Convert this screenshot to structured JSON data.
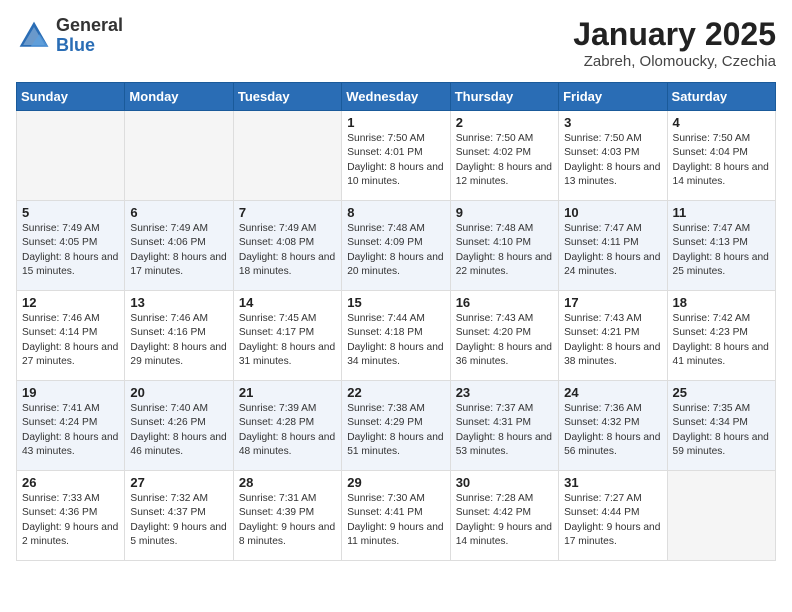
{
  "logo": {
    "general": "General",
    "blue": "Blue"
  },
  "title": "January 2025",
  "subtitle": "Zabreh, Olomoucky, Czechia",
  "days_of_week": [
    "Sunday",
    "Monday",
    "Tuesday",
    "Wednesday",
    "Thursday",
    "Friday",
    "Saturday"
  ],
  "weeks": [
    [
      {
        "day": "",
        "sunrise": "",
        "sunset": "",
        "daylight": ""
      },
      {
        "day": "",
        "sunrise": "",
        "sunset": "",
        "daylight": ""
      },
      {
        "day": "",
        "sunrise": "",
        "sunset": "",
        "daylight": ""
      },
      {
        "day": "1",
        "sunrise": "Sunrise: 7:50 AM",
        "sunset": "Sunset: 4:01 PM",
        "daylight": "Daylight: 8 hours and 10 minutes."
      },
      {
        "day": "2",
        "sunrise": "Sunrise: 7:50 AM",
        "sunset": "Sunset: 4:02 PM",
        "daylight": "Daylight: 8 hours and 12 minutes."
      },
      {
        "day": "3",
        "sunrise": "Sunrise: 7:50 AM",
        "sunset": "Sunset: 4:03 PM",
        "daylight": "Daylight: 8 hours and 13 minutes."
      },
      {
        "day": "4",
        "sunrise": "Sunrise: 7:50 AM",
        "sunset": "Sunset: 4:04 PM",
        "daylight": "Daylight: 8 hours and 14 minutes."
      }
    ],
    [
      {
        "day": "5",
        "sunrise": "Sunrise: 7:49 AM",
        "sunset": "Sunset: 4:05 PM",
        "daylight": "Daylight: 8 hours and 15 minutes."
      },
      {
        "day": "6",
        "sunrise": "Sunrise: 7:49 AM",
        "sunset": "Sunset: 4:06 PM",
        "daylight": "Daylight: 8 hours and 17 minutes."
      },
      {
        "day": "7",
        "sunrise": "Sunrise: 7:49 AM",
        "sunset": "Sunset: 4:08 PM",
        "daylight": "Daylight: 8 hours and 18 minutes."
      },
      {
        "day": "8",
        "sunrise": "Sunrise: 7:48 AM",
        "sunset": "Sunset: 4:09 PM",
        "daylight": "Daylight: 8 hours and 20 minutes."
      },
      {
        "day": "9",
        "sunrise": "Sunrise: 7:48 AM",
        "sunset": "Sunset: 4:10 PM",
        "daylight": "Daylight: 8 hours and 22 minutes."
      },
      {
        "day": "10",
        "sunrise": "Sunrise: 7:47 AM",
        "sunset": "Sunset: 4:11 PM",
        "daylight": "Daylight: 8 hours and 24 minutes."
      },
      {
        "day": "11",
        "sunrise": "Sunrise: 7:47 AM",
        "sunset": "Sunset: 4:13 PM",
        "daylight": "Daylight: 8 hours and 25 minutes."
      }
    ],
    [
      {
        "day": "12",
        "sunrise": "Sunrise: 7:46 AM",
        "sunset": "Sunset: 4:14 PM",
        "daylight": "Daylight: 8 hours and 27 minutes."
      },
      {
        "day": "13",
        "sunrise": "Sunrise: 7:46 AM",
        "sunset": "Sunset: 4:16 PM",
        "daylight": "Daylight: 8 hours and 29 minutes."
      },
      {
        "day": "14",
        "sunrise": "Sunrise: 7:45 AM",
        "sunset": "Sunset: 4:17 PM",
        "daylight": "Daylight: 8 hours and 31 minutes."
      },
      {
        "day": "15",
        "sunrise": "Sunrise: 7:44 AM",
        "sunset": "Sunset: 4:18 PM",
        "daylight": "Daylight: 8 hours and 34 minutes."
      },
      {
        "day": "16",
        "sunrise": "Sunrise: 7:43 AM",
        "sunset": "Sunset: 4:20 PM",
        "daylight": "Daylight: 8 hours and 36 minutes."
      },
      {
        "day": "17",
        "sunrise": "Sunrise: 7:43 AM",
        "sunset": "Sunset: 4:21 PM",
        "daylight": "Daylight: 8 hours and 38 minutes."
      },
      {
        "day": "18",
        "sunrise": "Sunrise: 7:42 AM",
        "sunset": "Sunset: 4:23 PM",
        "daylight": "Daylight: 8 hours and 41 minutes."
      }
    ],
    [
      {
        "day": "19",
        "sunrise": "Sunrise: 7:41 AM",
        "sunset": "Sunset: 4:24 PM",
        "daylight": "Daylight: 8 hours and 43 minutes."
      },
      {
        "day": "20",
        "sunrise": "Sunrise: 7:40 AM",
        "sunset": "Sunset: 4:26 PM",
        "daylight": "Daylight: 8 hours and 46 minutes."
      },
      {
        "day": "21",
        "sunrise": "Sunrise: 7:39 AM",
        "sunset": "Sunset: 4:28 PM",
        "daylight": "Daylight: 8 hours and 48 minutes."
      },
      {
        "day": "22",
        "sunrise": "Sunrise: 7:38 AM",
        "sunset": "Sunset: 4:29 PM",
        "daylight": "Daylight: 8 hours and 51 minutes."
      },
      {
        "day": "23",
        "sunrise": "Sunrise: 7:37 AM",
        "sunset": "Sunset: 4:31 PM",
        "daylight": "Daylight: 8 hours and 53 minutes."
      },
      {
        "day": "24",
        "sunrise": "Sunrise: 7:36 AM",
        "sunset": "Sunset: 4:32 PM",
        "daylight": "Daylight: 8 hours and 56 minutes."
      },
      {
        "day": "25",
        "sunrise": "Sunrise: 7:35 AM",
        "sunset": "Sunset: 4:34 PM",
        "daylight": "Daylight: 8 hours and 59 minutes."
      }
    ],
    [
      {
        "day": "26",
        "sunrise": "Sunrise: 7:33 AM",
        "sunset": "Sunset: 4:36 PM",
        "daylight": "Daylight: 9 hours and 2 minutes."
      },
      {
        "day": "27",
        "sunrise": "Sunrise: 7:32 AM",
        "sunset": "Sunset: 4:37 PM",
        "daylight": "Daylight: 9 hours and 5 minutes."
      },
      {
        "day": "28",
        "sunrise": "Sunrise: 7:31 AM",
        "sunset": "Sunset: 4:39 PM",
        "daylight": "Daylight: 9 hours and 8 minutes."
      },
      {
        "day": "29",
        "sunrise": "Sunrise: 7:30 AM",
        "sunset": "Sunset: 4:41 PM",
        "daylight": "Daylight: 9 hours and 11 minutes."
      },
      {
        "day": "30",
        "sunrise": "Sunrise: 7:28 AM",
        "sunset": "Sunset: 4:42 PM",
        "daylight": "Daylight: 9 hours and 14 minutes."
      },
      {
        "day": "31",
        "sunrise": "Sunrise: 7:27 AM",
        "sunset": "Sunset: 4:44 PM",
        "daylight": "Daylight: 9 hours and 17 minutes."
      },
      {
        "day": "",
        "sunrise": "",
        "sunset": "",
        "daylight": ""
      }
    ]
  ]
}
